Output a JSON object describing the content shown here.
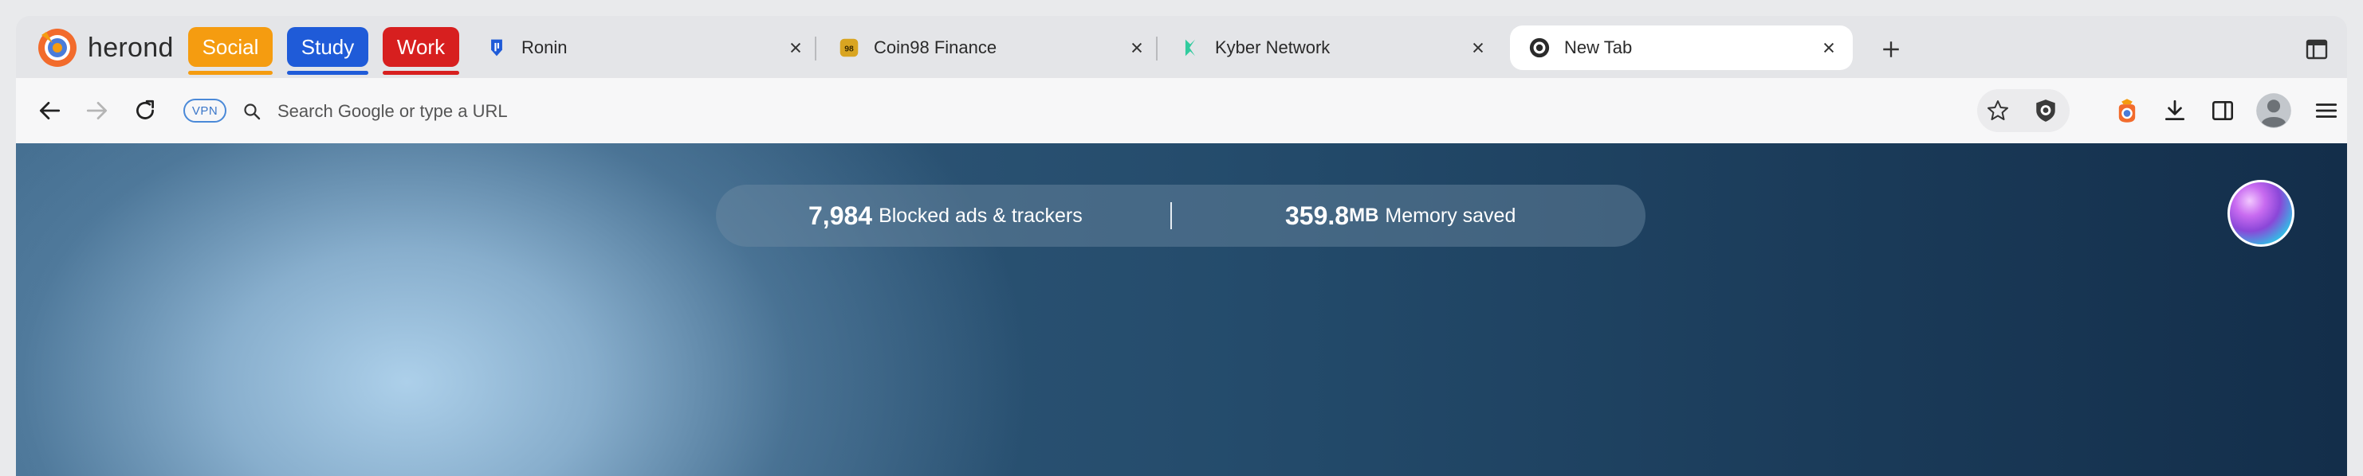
{
  "browser": {
    "brand_name": "herond",
    "brand_icon": "herond-logo-icon"
  },
  "tab_groups": [
    {
      "label": "Social",
      "color": "#f59c10"
    },
    {
      "label": "Study",
      "color": "#1f5bd8"
    },
    {
      "label": "Work",
      "color": "#d71f1f"
    }
  ],
  "tabs": [
    {
      "title": "Ronin",
      "icon": "ronin-shield-icon",
      "active": false
    },
    {
      "title": "Coin98 Finance",
      "icon": "coin98-icon",
      "active": false
    },
    {
      "title": "Kyber Network",
      "icon": "kyber-icon",
      "active": false
    },
    {
      "title": "New Tab",
      "icon": "herond-tab-icon",
      "active": true
    }
  ],
  "toolbar": {
    "vpn_label": "VPN",
    "search_placeholder": "Search Google or type a URL",
    "search_value": ""
  },
  "stats": {
    "blocked_count": "7,984",
    "blocked_label": "Blocked ads & trackers",
    "memory_value": "359.8",
    "memory_unit": "MB",
    "memory_label": "Memory saved"
  },
  "colors": {
    "accent": "#4a89d8",
    "content_dark": "#132e4a",
    "content_light": "#afd2ec"
  }
}
